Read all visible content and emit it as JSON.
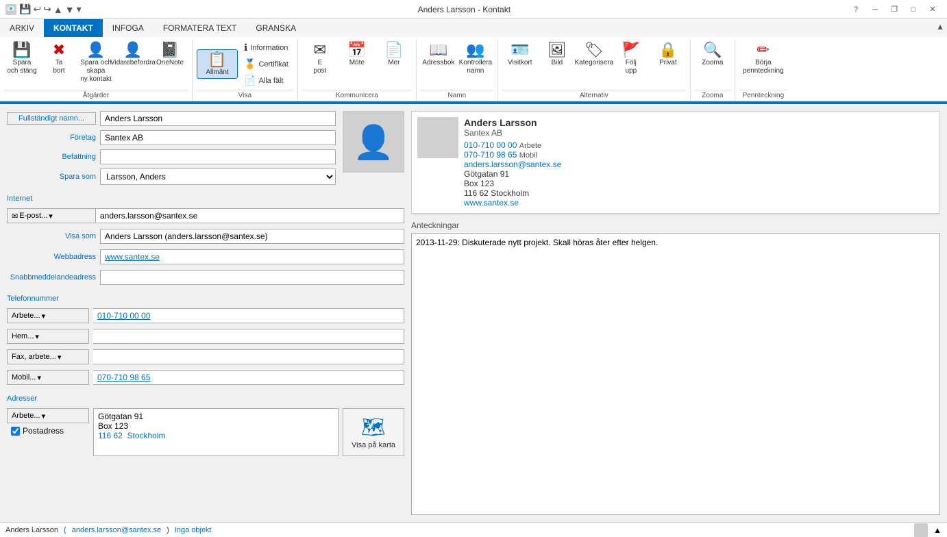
{
  "titleBar": {
    "title": "Anders Larsson - Kontakt",
    "controls": [
      "minimize",
      "restore",
      "maximize",
      "close"
    ],
    "quickAccess": [
      "save",
      "undo",
      "redo",
      "up",
      "down",
      "more"
    ]
  },
  "ribbon": {
    "tabs": [
      {
        "id": "arkiv",
        "label": "ARKIV",
        "active": false
      },
      {
        "id": "kontakt",
        "label": "KONTAKT",
        "active": true
      },
      {
        "id": "infoga",
        "label": "INFOGA",
        "active": false
      },
      {
        "id": "formatera",
        "label": "FORMATERA TEXT",
        "active": false
      },
      {
        "id": "granska",
        "label": "GRANSKA",
        "active": false
      }
    ],
    "groups": {
      "atgarder": {
        "label": "Åtgärder",
        "buttons": [
          {
            "id": "spara-stang",
            "icon": "💾",
            "label": "Spara\noch stäng"
          },
          {
            "id": "ta-bort",
            "icon": "✖",
            "label": "Ta\nbort"
          },
          {
            "id": "spara-skapa",
            "icon": "👤",
            "label": "Spara och skapa\nny kontakt"
          },
          {
            "id": "vidarebefordra",
            "icon": "👤",
            "label": "Vidarebefordra"
          },
          {
            "id": "onenote",
            "icon": "📓",
            "label": "OneNote"
          }
        ]
      },
      "visa": {
        "label": "Visa",
        "buttons_large": [
          {
            "id": "allmant",
            "icon": "📋",
            "label": "Allmänt",
            "active": true
          }
        ],
        "buttons_small": [
          {
            "id": "information",
            "label": "Information"
          },
          {
            "id": "certifikat",
            "label": "Certifikat"
          },
          {
            "id": "alla-falt",
            "label": "Alla fält"
          }
        ]
      },
      "kommunicera": {
        "label": "Kommunicera",
        "buttons": [
          {
            "id": "e-post",
            "icon": "✉",
            "label": "E\npost"
          },
          {
            "id": "mote",
            "icon": "📅",
            "label": "Möte"
          },
          {
            "id": "mer",
            "icon": "📄",
            "label": "Mer"
          }
        ]
      },
      "namn": {
        "label": "Namn",
        "buttons": [
          {
            "id": "adressbok",
            "icon": "📖",
            "label": "Adressbok"
          },
          {
            "id": "kontrollera-namn",
            "icon": "👥",
            "label": "Kontrollera\nnamn"
          }
        ]
      },
      "alternativ": {
        "label": "Alternativ",
        "buttons": [
          {
            "id": "visitkort",
            "icon": "🪪",
            "label": "Visitkort"
          },
          {
            "id": "bild",
            "icon": "🖼",
            "label": "Bild"
          },
          {
            "id": "kategorisera",
            "icon": "🏷",
            "label": "Kategorisera"
          },
          {
            "id": "folj-upp",
            "icon": "🚩",
            "label": "Följ\nupp"
          },
          {
            "id": "privat",
            "icon": "🔒",
            "label": "Privat"
          }
        ]
      },
      "zooma": {
        "label": "Zooma",
        "buttons": [
          {
            "id": "zooma",
            "icon": "🔍",
            "label": "Zooma"
          }
        ]
      },
      "pennteckning": {
        "label": "Pennteckning",
        "buttons": [
          {
            "id": "borja-pennteckning",
            "icon": "✏",
            "label": "Börja\npennteckning"
          }
        ]
      }
    }
  },
  "form": {
    "fullnamn_btn": "Fullständigt namn...",
    "fullnamn_val": "Anders Larsson",
    "foretag_label": "Företag",
    "foretag_val": "Santex AB",
    "befattning_label": "Befattning",
    "befattning_val": "",
    "spara_som_label": "Spara som",
    "spara_som_val": "Larsson, Anders",
    "internet_label": "Internet",
    "email_btn": "E-post...",
    "email_val": "anders.larsson@santex.se",
    "visa_som_label": "Visa som",
    "visa_som_val": "Anders Larsson (anders.larsson@santex.se)",
    "webbadress_label": "Webbadress",
    "webbadress_val": "www.santex.se",
    "snabb_label": "Snabbmeddelandeadress",
    "snabb_val": "",
    "telefon_label": "Telefonnummer",
    "phone_rows": [
      {
        "type_btn": "Arbete...",
        "val": "010-710 00 00"
      },
      {
        "type_btn": "Hem...",
        "val": ""
      },
      {
        "type_btn": "Fax, arbete...",
        "val": ""
      },
      {
        "type_btn": "Mobil...",
        "val": "070-710 98 65"
      }
    ],
    "adresser_label": "Adresser",
    "addr_type_btn": "Arbete...",
    "addr_lines": "Götgatan 91\nBox 123\n116 62  Stockholm",
    "postadress_label": "Postadress",
    "map_btn_label": "Visa på karta"
  },
  "card": {
    "name": "Anders Larsson",
    "company": "Santex AB",
    "phone_work_label": "010-710 00 00",
    "phone_work_type": "Arbete",
    "phone_mob_label": "070-710 98 65",
    "phone_mob_type": "Mobil",
    "email": "anders.larsson@santex.se",
    "addr1": "Götgatan 91",
    "addr2": "Box 123",
    "addr3": "116 62  Stockholm",
    "website": "www.santex.se"
  },
  "notes": {
    "label": "Anteckningar",
    "content": "2013-11-29: Diskuterade nytt projekt. Skall höras åter efter helgen."
  },
  "statusBar": {
    "name": "Anders Larsson",
    "email": "anders.larsson@santex.se",
    "suffix": "Inga objekt"
  }
}
